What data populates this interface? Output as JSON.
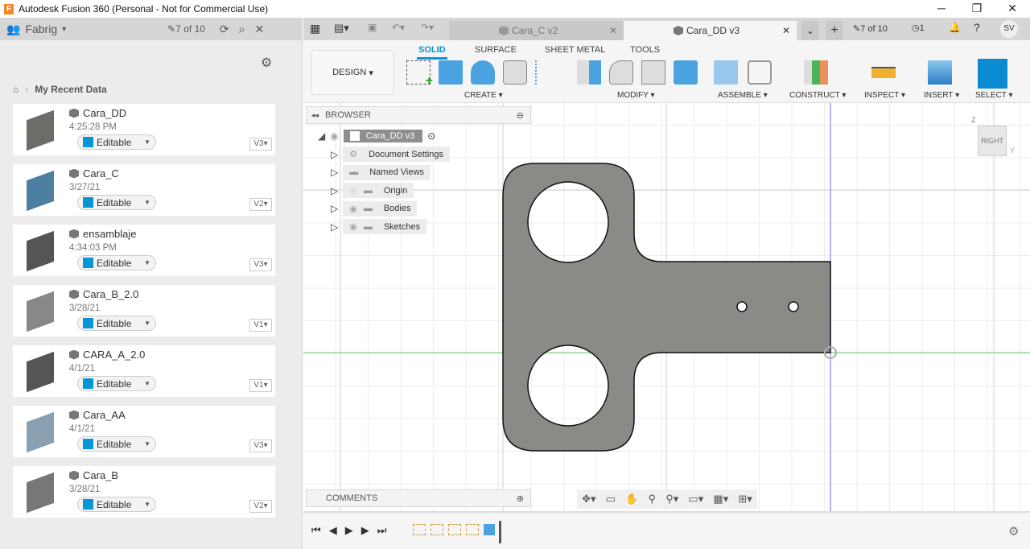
{
  "window": {
    "title": "Autodesk Fusion 360 (Personal - Not for Commercial Use)",
    "logo": "F"
  },
  "data_panel": {
    "team": "Fabrig",
    "count": "7 of 10",
    "breadcrumb": "My Recent Data",
    "items": [
      {
        "name": "Cara_DD",
        "date": "4:25:28 PM",
        "status": "Editable",
        "version": "V3"
      },
      {
        "name": "Cara_C",
        "date": "3/27/21",
        "status": "Editable",
        "version": "V2"
      },
      {
        "name": "ensamblaje",
        "date": "4:34:03 PM",
        "status": "Editable",
        "version": "V3"
      },
      {
        "name": "Cara_B_2.0",
        "date": "3/28/21",
        "status": "Editable",
        "version": "V1"
      },
      {
        "name": "CARA_A_2.0",
        "date": "4/1/21",
        "status": "Editable",
        "version": "V1"
      },
      {
        "name": "Cara_AA",
        "date": "4/1/21",
        "status": "Editable",
        "version": "V3"
      },
      {
        "name": "Cara_B",
        "date": "3/28/21",
        "status": "Editable",
        "version": "V2"
      }
    ]
  },
  "tabs": [
    {
      "label": "Cara_C v2"
    },
    {
      "label": "Cara_DD v3",
      "active": true
    }
  ],
  "header_right": {
    "count": "7 of 10",
    "jobs": "1",
    "avatar": "SV"
  },
  "toolbar": {
    "workspace": "DESIGN",
    "tabs": [
      "SOLID",
      "SURFACE",
      "SHEET METAL",
      "TOOLS"
    ],
    "active_tab": "SOLID",
    "groups": [
      "CREATE",
      "MODIFY",
      "ASSEMBLE",
      "CONSTRUCT",
      "INSPECT",
      "INSERT",
      "SELECT"
    ]
  },
  "browser": {
    "title": "BROWSER",
    "root": "Cara_DD v3",
    "nodes": [
      "Document Settings",
      "Named Views",
      "Origin",
      "Bodies",
      "Sketches"
    ]
  },
  "comments": {
    "title": "COMMENTS"
  },
  "viewcube": {
    "face": "RIGHT",
    "axis_z": "Z",
    "axis_y": "Y"
  },
  "colors": {
    "accent": "#0696d7",
    "part": "#8a8a86",
    "x_axis": "#9bd99b",
    "z_axis": "#9c9cf0"
  }
}
